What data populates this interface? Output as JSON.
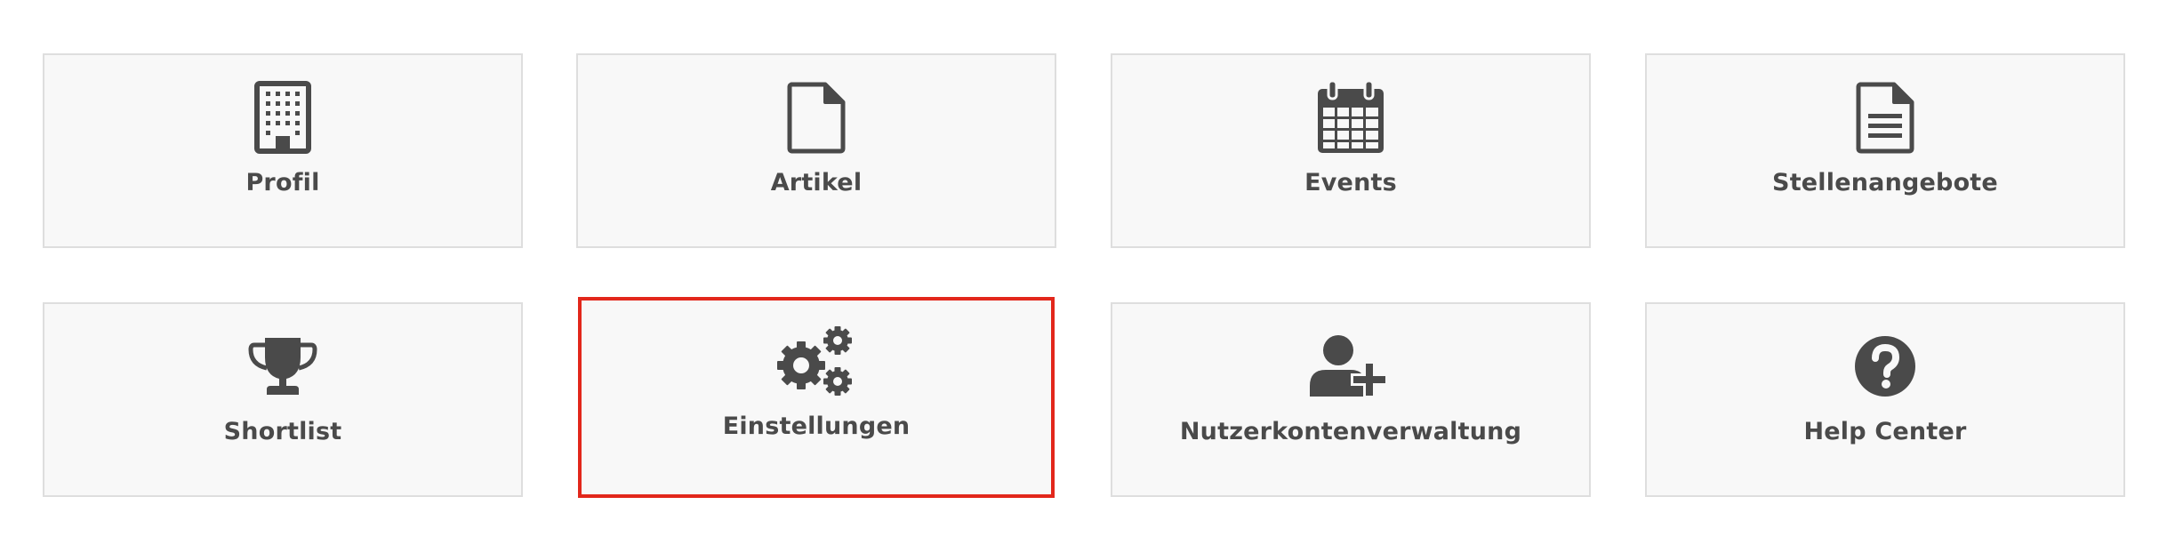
{
  "tiles": [
    {
      "label": "Profil",
      "icon": "building-icon"
    },
    {
      "label": "Artikel",
      "icon": "document-icon"
    },
    {
      "label": "Events",
      "icon": "calendar-icon"
    },
    {
      "label": "Stellenangebote",
      "icon": "document-lines-icon"
    },
    {
      "label": "Shortlist",
      "icon": "trophy-icon"
    },
    {
      "label": "Einstellungen",
      "icon": "gears-icon",
      "selected": true
    },
    {
      "label": "Nutzerkontenverwaltung",
      "icon": "user-plus-icon"
    },
    {
      "label": "Help Center",
      "icon": "question-circle-icon"
    }
  ],
  "colors": {
    "icon": "#4a4a4a",
    "tile_background": "#f8f8f8",
    "tile_border": "#dedede",
    "selected_border": "#e2271b"
  }
}
